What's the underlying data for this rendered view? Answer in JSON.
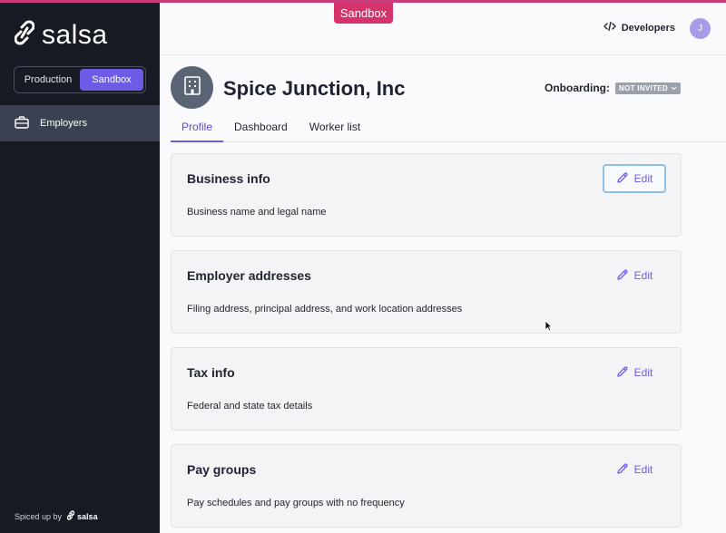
{
  "env_badge": "Sandbox",
  "sidebar": {
    "logo_text": "salsa",
    "env_options": [
      "Production",
      "Sandbox"
    ],
    "nav_items": [
      {
        "label": "Employers",
        "icon": "briefcase-icon"
      }
    ],
    "footer_text": "Spiced up by",
    "footer_brand": "salsa"
  },
  "topbar": {
    "developers_label": "Developers",
    "avatar_initial": "J"
  },
  "company": {
    "name": "Spice Junction, Inc",
    "onboarding_label": "Onboarding:",
    "onboarding_status": "NOT INVITED"
  },
  "tabs": [
    "Profile",
    "Dashboard",
    "Worker list"
  ],
  "cards": [
    {
      "title": "Business info",
      "description": "Business name and legal name",
      "edit_label": "Edit"
    },
    {
      "title": "Employer addresses",
      "description": "Filing address, principal address, and work location addresses",
      "edit_label": "Edit"
    },
    {
      "title": "Tax info",
      "description": "Federal and state tax details",
      "edit_label": "Edit"
    },
    {
      "title": "Pay groups",
      "description": "Pay schedules and pay groups with no frequency",
      "edit_label": "Edit"
    }
  ],
  "colors": {
    "accent": "#6c5ce7",
    "sidebar_bg": "#161a23",
    "env_badge": "#d6336c"
  }
}
